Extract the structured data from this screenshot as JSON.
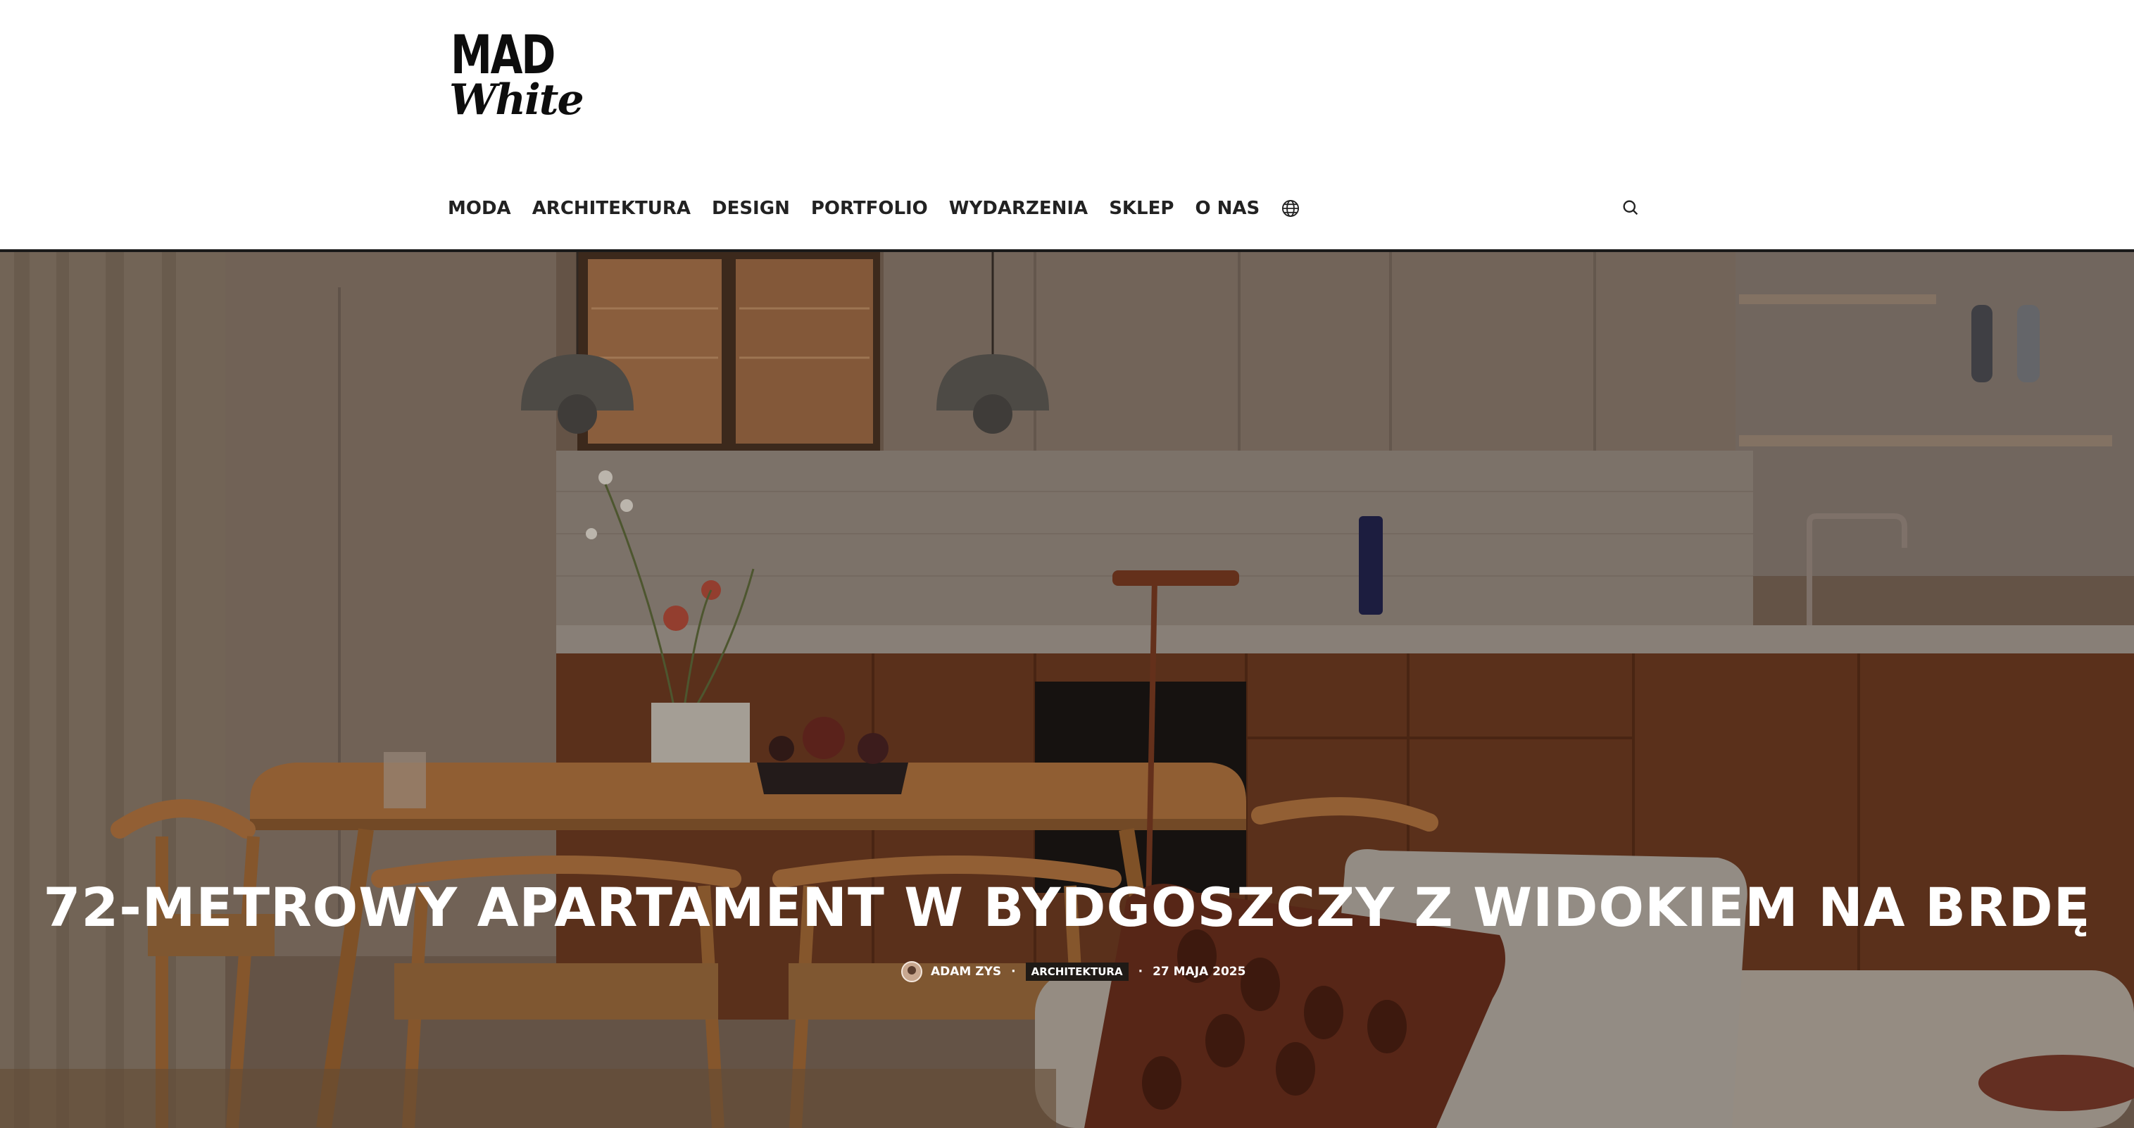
{
  "logo": {
    "line1": "MAD",
    "line2": "White"
  },
  "nav": {
    "items": [
      {
        "label": "MODA"
      },
      {
        "label": "ARCHITEKTURA"
      },
      {
        "label": "DESIGN"
      },
      {
        "label": "PORTFOLIO"
      },
      {
        "label": "WYDARZENIA"
      },
      {
        "label": "SKLEP"
      },
      {
        "label": "O NAS"
      }
    ],
    "globe_icon": "globe-icon",
    "search_icon": "search-icon"
  },
  "article": {
    "title": "72-METROWY APARTAMENT W BYDGOSZCZY Z WIDOKIEM NA BRDĘ",
    "author": "ADAM ZYS",
    "category": "ARCHITEKTURA",
    "date": "27 MAJA 2025"
  },
  "colors": {
    "text_dark": "#222222",
    "hero_overlay": "#6b5646",
    "white": "#ffffff"
  }
}
